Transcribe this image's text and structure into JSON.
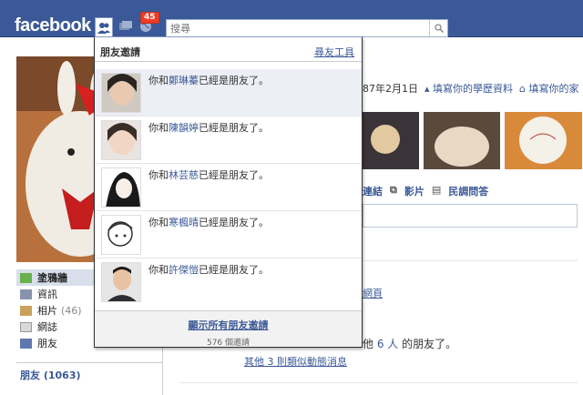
{
  "topbar": {
    "logo": "facebook",
    "notification_count": "45",
    "search_placeholder": "搜尋"
  },
  "left_nav": {
    "items": [
      {
        "label": "塗鴉牆",
        "count": ""
      },
      {
        "label": "資訊",
        "count": ""
      },
      {
        "label": "相片",
        "count": "(46)"
      },
      {
        "label": "網誌",
        "count": ""
      },
      {
        "label": "朋友",
        "count": ""
      }
    ],
    "friends_heading": "朋友 (1063)"
  },
  "profile": {
    "info_date": "87年2月1日",
    "fill_school": "填寫你的學歷資料",
    "fill_home": "填寫你的家"
  },
  "publisher": {
    "link": "連結",
    "video": "影片",
    "poll": "民調問答"
  },
  "feed": {
    "fragment_link": "網頁",
    "story_prefix": "他",
    "story_count": "6 人",
    "story_suffix": "的朋友了。",
    "more_link": "其他 3 則類似動態消息"
  },
  "dropdown": {
    "title": "朋友邀請",
    "tool": "尋友工具",
    "items": [
      {
        "prefix": "你和",
        "name": "鄭琳蓁",
        "suffix": "已經是朋友了。"
      },
      {
        "prefix": "你和",
        "name": "陳韻婷",
        "suffix": "已經是朋友了。"
      },
      {
        "prefix": "你和",
        "name": "林芸慈",
        "suffix": "已經是朋友了。"
      },
      {
        "prefix": "你和",
        "name": "寒楓晴",
        "suffix": "已經是朋友了。"
      },
      {
        "prefix": "你和",
        "name": "許傑愷",
        "suffix": "已經是朋友了。"
      }
    ],
    "show_all": "顯示所有朋友邀請",
    "request_count": "576 個邀請"
  },
  "colors": {
    "brand": "#3b5998",
    "badge": "#f03d25",
    "link": "#3b5998"
  }
}
